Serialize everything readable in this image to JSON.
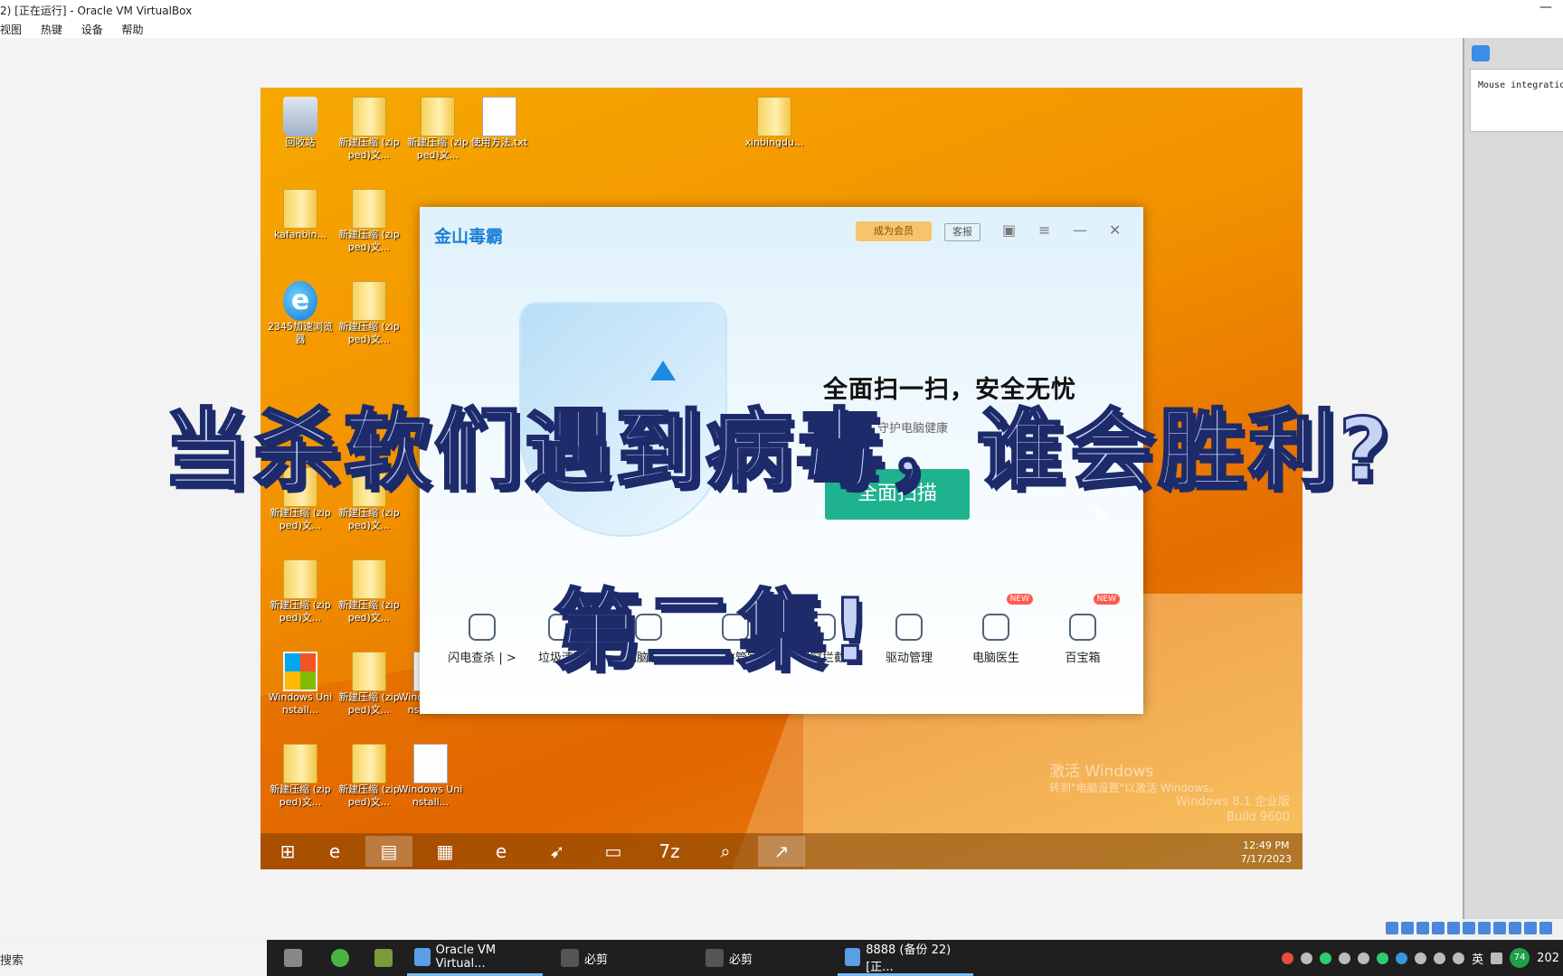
{
  "host_window": {
    "title": "2) [正在运行] - Oracle VM VirtualBox",
    "menu": [
      "视图",
      "热键",
      "设备",
      "帮助"
    ]
  },
  "vm_desktop": {
    "icons": [
      {
        "label": "回收站",
        "type": "recycle"
      },
      {
        "label": "新建压缩 (zipped)文...",
        "type": "folder"
      },
      {
        "label": "新建压缩 (zipped)文...",
        "type": "folder"
      },
      {
        "label": "使用方法.txt",
        "type": "file"
      },
      {
        "label": "xinbingdu...",
        "type": "folder"
      },
      {
        "label": "kafanbin...",
        "type": "folder"
      },
      {
        "label": "新建压缩 (zipped)文...",
        "type": "folder"
      },
      {
        "label": "2345加速浏览器",
        "type": "ie"
      },
      {
        "label": "新建压缩 (zipped)文...",
        "type": "folder"
      },
      {
        "label": "新建压缩 (zipped)文...",
        "type": "folder"
      },
      {
        "label": "新建压缩 (zipped)文...",
        "type": "folder"
      },
      {
        "label": "新建压缩 (zipped)文...",
        "type": "folder"
      },
      {
        "label": "新建压缩 (zipped)文...",
        "type": "folder"
      },
      {
        "label": "Windows Uninstall...",
        "type": "windows"
      },
      {
        "label": "新建压缩 (zipped)文...",
        "type": "folder"
      },
      {
        "label": "Windows Uninstaller...",
        "type": "file"
      },
      {
        "label": "新建压缩 (zipped)文...",
        "type": "folder"
      },
      {
        "label": "新建压缩 (zipped)文...",
        "type": "folder"
      },
      {
        "label": "Windows Uninstall...",
        "type": "file"
      }
    ],
    "watermark_title": "激活 Windows",
    "watermark_sub": "转到\"电脑设置\"以激活 Windows。",
    "edition": "Windows 8.1 企业版",
    "build": "Build 9600",
    "clock_time": "12:49 PM",
    "clock_date": "7/17/2023"
  },
  "av_app": {
    "logo": "金山毒霸",
    "vip_label": "成为会员",
    "report_label": "客报",
    "headline": "全面扫一扫，安全无忧",
    "subline": "毒，守护电脑健康",
    "scan_button": "全面扫描",
    "tools": [
      {
        "label": "闪电查杀 | >",
        "badge": ""
      },
      {
        "label": "垃圾清理",
        "badge": ""
      },
      {
        "label": "电脑加速",
        "badge": ""
      },
      {
        "label": "软件管家",
        "badge": ""
      },
      {
        "label": "弹窗拦截",
        "badge": ""
      },
      {
        "label": "驱动管理",
        "badge": ""
      },
      {
        "label": "电脑医生",
        "badge": "NEW"
      },
      {
        "label": "百宝箱",
        "badge": "NEW"
      }
    ]
  },
  "overlay": {
    "title": "当杀软们遇到病毒，谁会胜利?",
    "subtitle": "第二集!"
  },
  "right_panel": {
    "notice": "Mouse integratio"
  },
  "host_taskbar": {
    "search_text": "搜索",
    "items": [
      {
        "label": "",
        "icon": "task-view-icon"
      },
      {
        "label": "",
        "icon": "app-green-icon"
      },
      {
        "label": "",
        "icon": "box-icon"
      },
      {
        "label": "Oracle VM Virtual...",
        "icon": "virtualbox-icon"
      },
      {
        "label": "必剪",
        "icon": "bilibili-icon"
      },
      {
        "label": "必剪",
        "icon": "bilibili-icon"
      },
      {
        "label": "8888 (备份 22) [正...",
        "icon": "vm-icon"
      }
    ],
    "ime": "英",
    "badge": "74",
    "year": "202"
  }
}
